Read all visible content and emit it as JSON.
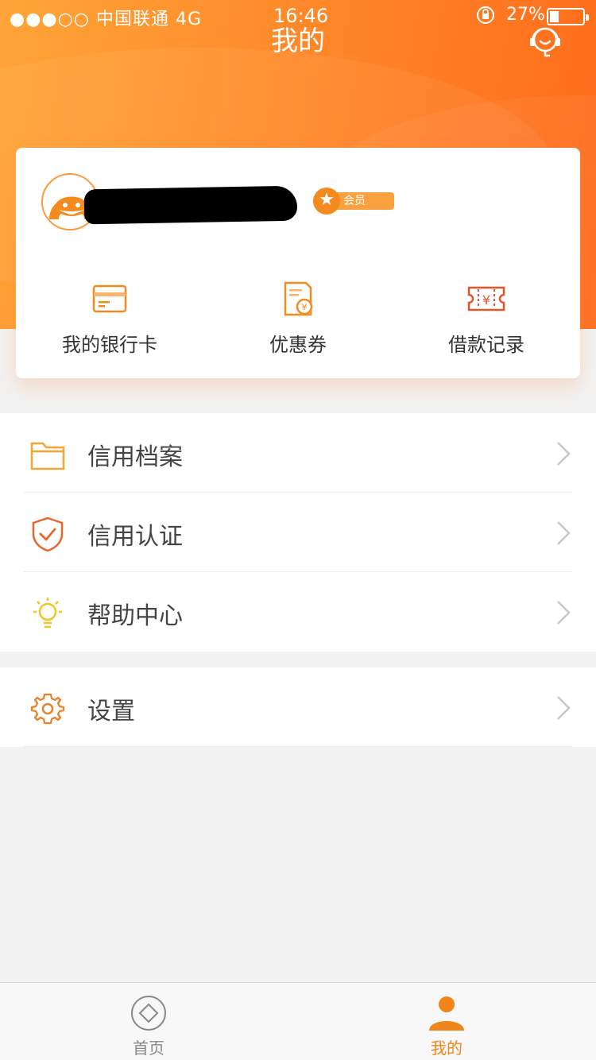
{
  "status_bar": {
    "carrier": "●●●○○ 中国联通   4G",
    "time": "16:46",
    "battery_percent": "27%",
    "battery_level": 0.27
  },
  "header": {
    "title": "我的",
    "support_icon": "headset-support-icon",
    "gradient": [
      "#ffa538",
      "#ff6a1a"
    ]
  },
  "profile": {
    "username": "",
    "member_label": "会员"
  },
  "quick_actions": [
    {
      "label": "我的银行卡",
      "icon": "bank-card-icon"
    },
    {
      "label": "优惠券",
      "icon": "coupon-icon"
    },
    {
      "label": "借款记录",
      "icon": "loan-record-icon"
    }
  ],
  "menu": [
    {
      "label": "信用档案",
      "icon": "folder-icon"
    },
    {
      "label": "信用认证",
      "icon": "shield-check-icon"
    },
    {
      "label": "帮助中心",
      "icon": "lightbulb-icon"
    },
    {
      "label": "设置",
      "icon": "gear-icon"
    }
  ],
  "tabbar": [
    {
      "label": "首页",
      "icon": "home-diamond-icon",
      "active": false
    },
    {
      "label": "我的",
      "icon": "person-icon",
      "active": true
    }
  ],
  "colors": {
    "accent": "#f58a1f",
    "tab_active": "#f08519",
    "tab_inactive": "#888888"
  }
}
